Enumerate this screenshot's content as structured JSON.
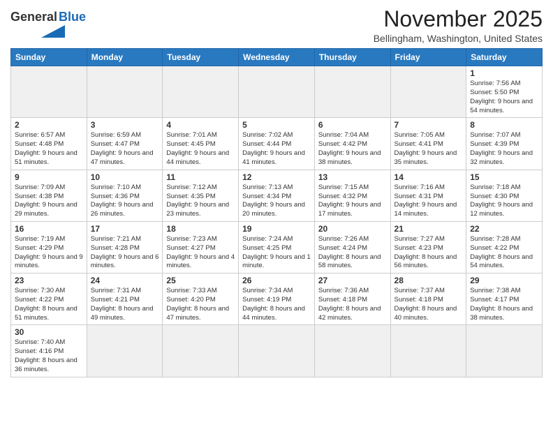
{
  "header": {
    "logo_general": "General",
    "logo_blue": "Blue",
    "month_title": "November 2025",
    "location": "Bellingham, Washington, United States"
  },
  "days_of_week": [
    "Sunday",
    "Monday",
    "Tuesday",
    "Wednesday",
    "Thursday",
    "Friday",
    "Saturday"
  ],
  "weeks": [
    [
      {
        "day": "",
        "info": ""
      },
      {
        "day": "",
        "info": ""
      },
      {
        "day": "",
        "info": ""
      },
      {
        "day": "",
        "info": ""
      },
      {
        "day": "",
        "info": ""
      },
      {
        "day": "",
        "info": ""
      },
      {
        "day": "1",
        "info": "Sunrise: 7:56 AM\nSunset: 5:50 PM\nDaylight: 9 hours\nand 54 minutes."
      }
    ],
    [
      {
        "day": "2",
        "info": "Sunrise: 6:57 AM\nSunset: 4:48 PM\nDaylight: 9 hours\nand 51 minutes."
      },
      {
        "day": "3",
        "info": "Sunrise: 6:59 AM\nSunset: 4:47 PM\nDaylight: 9 hours\nand 47 minutes."
      },
      {
        "day": "4",
        "info": "Sunrise: 7:01 AM\nSunset: 4:45 PM\nDaylight: 9 hours\nand 44 minutes."
      },
      {
        "day": "5",
        "info": "Sunrise: 7:02 AM\nSunset: 4:44 PM\nDaylight: 9 hours\nand 41 minutes."
      },
      {
        "day": "6",
        "info": "Sunrise: 7:04 AM\nSunset: 4:42 PM\nDaylight: 9 hours\nand 38 minutes."
      },
      {
        "day": "7",
        "info": "Sunrise: 7:05 AM\nSunset: 4:41 PM\nDaylight: 9 hours\nand 35 minutes."
      },
      {
        "day": "8",
        "info": "Sunrise: 7:07 AM\nSunset: 4:39 PM\nDaylight: 9 hours\nand 32 minutes."
      }
    ],
    [
      {
        "day": "9",
        "info": "Sunrise: 7:09 AM\nSunset: 4:38 PM\nDaylight: 9 hours\nand 29 minutes."
      },
      {
        "day": "10",
        "info": "Sunrise: 7:10 AM\nSunset: 4:36 PM\nDaylight: 9 hours\nand 26 minutes."
      },
      {
        "day": "11",
        "info": "Sunrise: 7:12 AM\nSunset: 4:35 PM\nDaylight: 9 hours\nand 23 minutes."
      },
      {
        "day": "12",
        "info": "Sunrise: 7:13 AM\nSunset: 4:34 PM\nDaylight: 9 hours\nand 20 minutes."
      },
      {
        "day": "13",
        "info": "Sunrise: 7:15 AM\nSunset: 4:32 PM\nDaylight: 9 hours\nand 17 minutes."
      },
      {
        "day": "14",
        "info": "Sunrise: 7:16 AM\nSunset: 4:31 PM\nDaylight: 9 hours\nand 14 minutes."
      },
      {
        "day": "15",
        "info": "Sunrise: 7:18 AM\nSunset: 4:30 PM\nDaylight: 9 hours\nand 12 minutes."
      }
    ],
    [
      {
        "day": "16",
        "info": "Sunrise: 7:19 AM\nSunset: 4:29 PM\nDaylight: 9 hours\nand 9 minutes."
      },
      {
        "day": "17",
        "info": "Sunrise: 7:21 AM\nSunset: 4:28 PM\nDaylight: 9 hours\nand 6 minutes."
      },
      {
        "day": "18",
        "info": "Sunrise: 7:23 AM\nSunset: 4:27 PM\nDaylight: 9 hours\nand 4 minutes."
      },
      {
        "day": "19",
        "info": "Sunrise: 7:24 AM\nSunset: 4:25 PM\nDaylight: 9 hours\nand 1 minute."
      },
      {
        "day": "20",
        "info": "Sunrise: 7:26 AM\nSunset: 4:24 PM\nDaylight: 8 hours\nand 58 minutes."
      },
      {
        "day": "21",
        "info": "Sunrise: 7:27 AM\nSunset: 4:23 PM\nDaylight: 8 hours\nand 56 minutes."
      },
      {
        "day": "22",
        "info": "Sunrise: 7:28 AM\nSunset: 4:22 PM\nDaylight: 8 hours\nand 54 minutes."
      }
    ],
    [
      {
        "day": "23",
        "info": "Sunrise: 7:30 AM\nSunset: 4:22 PM\nDaylight: 8 hours\nand 51 minutes."
      },
      {
        "day": "24",
        "info": "Sunrise: 7:31 AM\nSunset: 4:21 PM\nDaylight: 8 hours\nand 49 minutes."
      },
      {
        "day": "25",
        "info": "Sunrise: 7:33 AM\nSunset: 4:20 PM\nDaylight: 8 hours\nand 47 minutes."
      },
      {
        "day": "26",
        "info": "Sunrise: 7:34 AM\nSunset: 4:19 PM\nDaylight: 8 hours\nand 44 minutes."
      },
      {
        "day": "27",
        "info": "Sunrise: 7:36 AM\nSunset: 4:18 PM\nDaylight: 8 hours\nand 42 minutes."
      },
      {
        "day": "28",
        "info": "Sunrise: 7:37 AM\nSunset: 4:18 PM\nDaylight: 8 hours\nand 40 minutes."
      },
      {
        "day": "29",
        "info": "Sunrise: 7:38 AM\nSunset: 4:17 PM\nDaylight: 8 hours\nand 38 minutes."
      }
    ],
    [
      {
        "day": "30",
        "info": "Sunrise: 7:40 AM\nSunset: 4:16 PM\nDaylight: 8 hours\nand 36 minutes."
      },
      {
        "day": "",
        "info": ""
      },
      {
        "day": "",
        "info": ""
      },
      {
        "day": "",
        "info": ""
      },
      {
        "day": "",
        "info": ""
      },
      {
        "day": "",
        "info": ""
      },
      {
        "day": "",
        "info": ""
      }
    ]
  ]
}
